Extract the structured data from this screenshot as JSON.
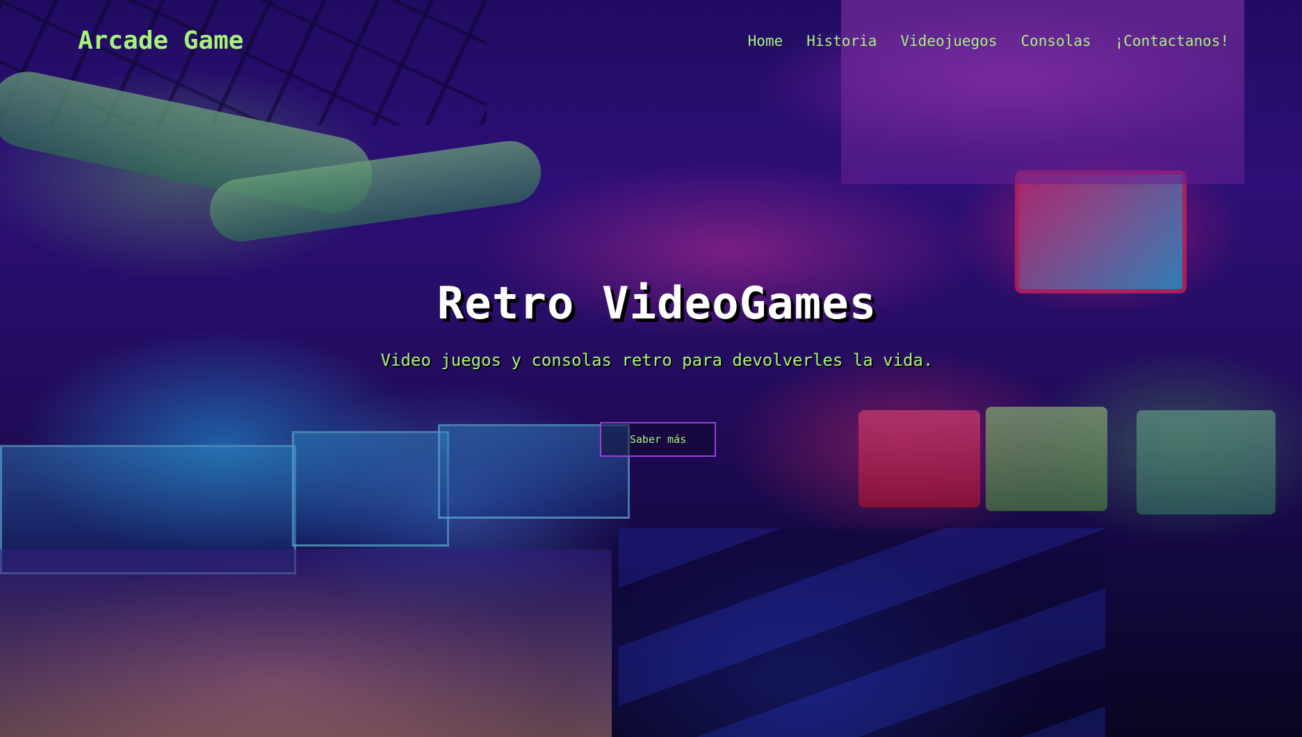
{
  "brand": {
    "name": "Arcade Game"
  },
  "nav": {
    "items": [
      {
        "label": "Home"
      },
      {
        "label": "Historia"
      },
      {
        "label": "Videojuegos"
      },
      {
        "label": "Consolas"
      },
      {
        "label": "¡Contactanos!"
      }
    ]
  },
  "hero": {
    "title": "Retro VideoGames",
    "subtitle": "Video juegos y consolas retro para devolverles la vida.",
    "cta_label": "Saber más"
  },
  "colors": {
    "accent_green": "#a8f27c",
    "button_border": "#9b3fe0",
    "title_white": "#ffffff"
  }
}
